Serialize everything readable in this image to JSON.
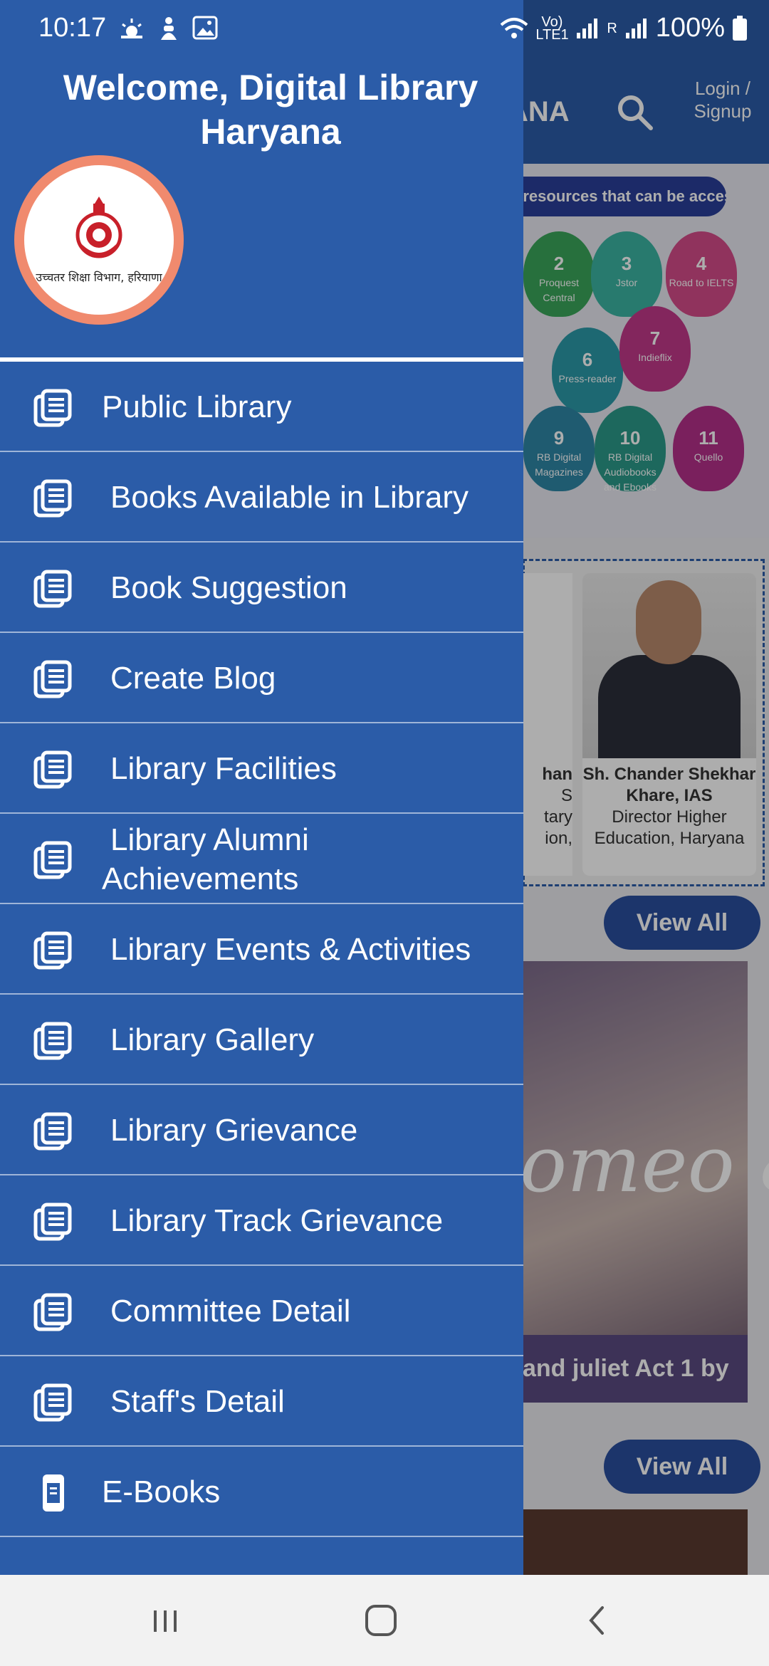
{
  "status_bar": {
    "time": "10:17",
    "network_label": "Vo) LTE1",
    "sim_label": "R",
    "battery": "100%"
  },
  "app": {
    "brand_partial": "YANA",
    "login_label": "Login / Signup",
    "banner_text": "y resources that can be accessed",
    "resources": [
      {
        "num": "2",
        "name": "Proquest Central",
        "color": "#3aa55a"
      },
      {
        "num": "3",
        "name": "Jstor",
        "color": "#3bb4a2"
      },
      {
        "num": "4",
        "name": "Road to IELTS",
        "color": "#d44c8a"
      },
      {
        "num": "6",
        "name": "Press-reader",
        "color": "#2b9aa8"
      },
      {
        "num": "7",
        "name": "Indieflix",
        "color": "#c2398a"
      },
      {
        "num": "9",
        "name": "RB Digital Magazines",
        "color": "#2f86a6"
      },
      {
        "num": "10",
        "name": "RB Digital Audiobooks and Ebooks",
        "color": "#2b9a8a"
      },
      {
        "num": "11",
        "name": "Quello",
        "color": "#b4308a"
      }
    ],
    "cut_card_lines": [
      "han",
      "S",
      "tary",
      "ion,"
    ],
    "person": {
      "name": "Sh. Chander Shekhar Khare, IAS",
      "role": "Director Higher Education, Haryana"
    },
    "view_all_label": "View All",
    "book_title": "omeo & Juliet",
    "book_caption": "and juliet Act 1 by"
  },
  "drawer": {
    "title": "Welcome, Digital Library Haryana",
    "logo_text": "उच्चतर शिक्षा विभाग, हरियाणा",
    "menu": [
      {
        "label": "Public Library",
        "icon": "library-list-icon"
      },
      {
        "label": "Books Available in Library",
        "icon": "library-list-icon"
      },
      {
        "label": "Book Suggestion",
        "icon": "library-list-icon"
      },
      {
        "label": "Create Blog",
        "icon": "library-list-icon"
      },
      {
        "label": "Library Facilities",
        "icon": "library-list-icon"
      },
      {
        "label": "Library Alumni Achievements",
        "icon": "library-list-icon"
      },
      {
        "label": "Library Events & Activities",
        "icon": "library-list-icon"
      },
      {
        "label": "Library Gallery",
        "icon": "library-list-icon"
      },
      {
        "label": "Library Grievance",
        "icon": "library-list-icon"
      },
      {
        "label": "Library Track Grievance",
        "icon": "library-list-icon"
      },
      {
        "label": "Committee Detail",
        "icon": "library-list-icon"
      },
      {
        "label": "Staff's Detail",
        "icon": "library-list-icon"
      },
      {
        "label": "E-Books",
        "icon": "ebook-icon"
      }
    ]
  },
  "navbar": {
    "recent_icon": "recent-apps-icon",
    "home_icon": "home-icon",
    "back_icon": "back-icon"
  },
  "colors": {
    "drawer_bg": "#2b5ca8",
    "logo_ring": "#f08a6e",
    "view_all_bg": "#2a4f9e"
  }
}
